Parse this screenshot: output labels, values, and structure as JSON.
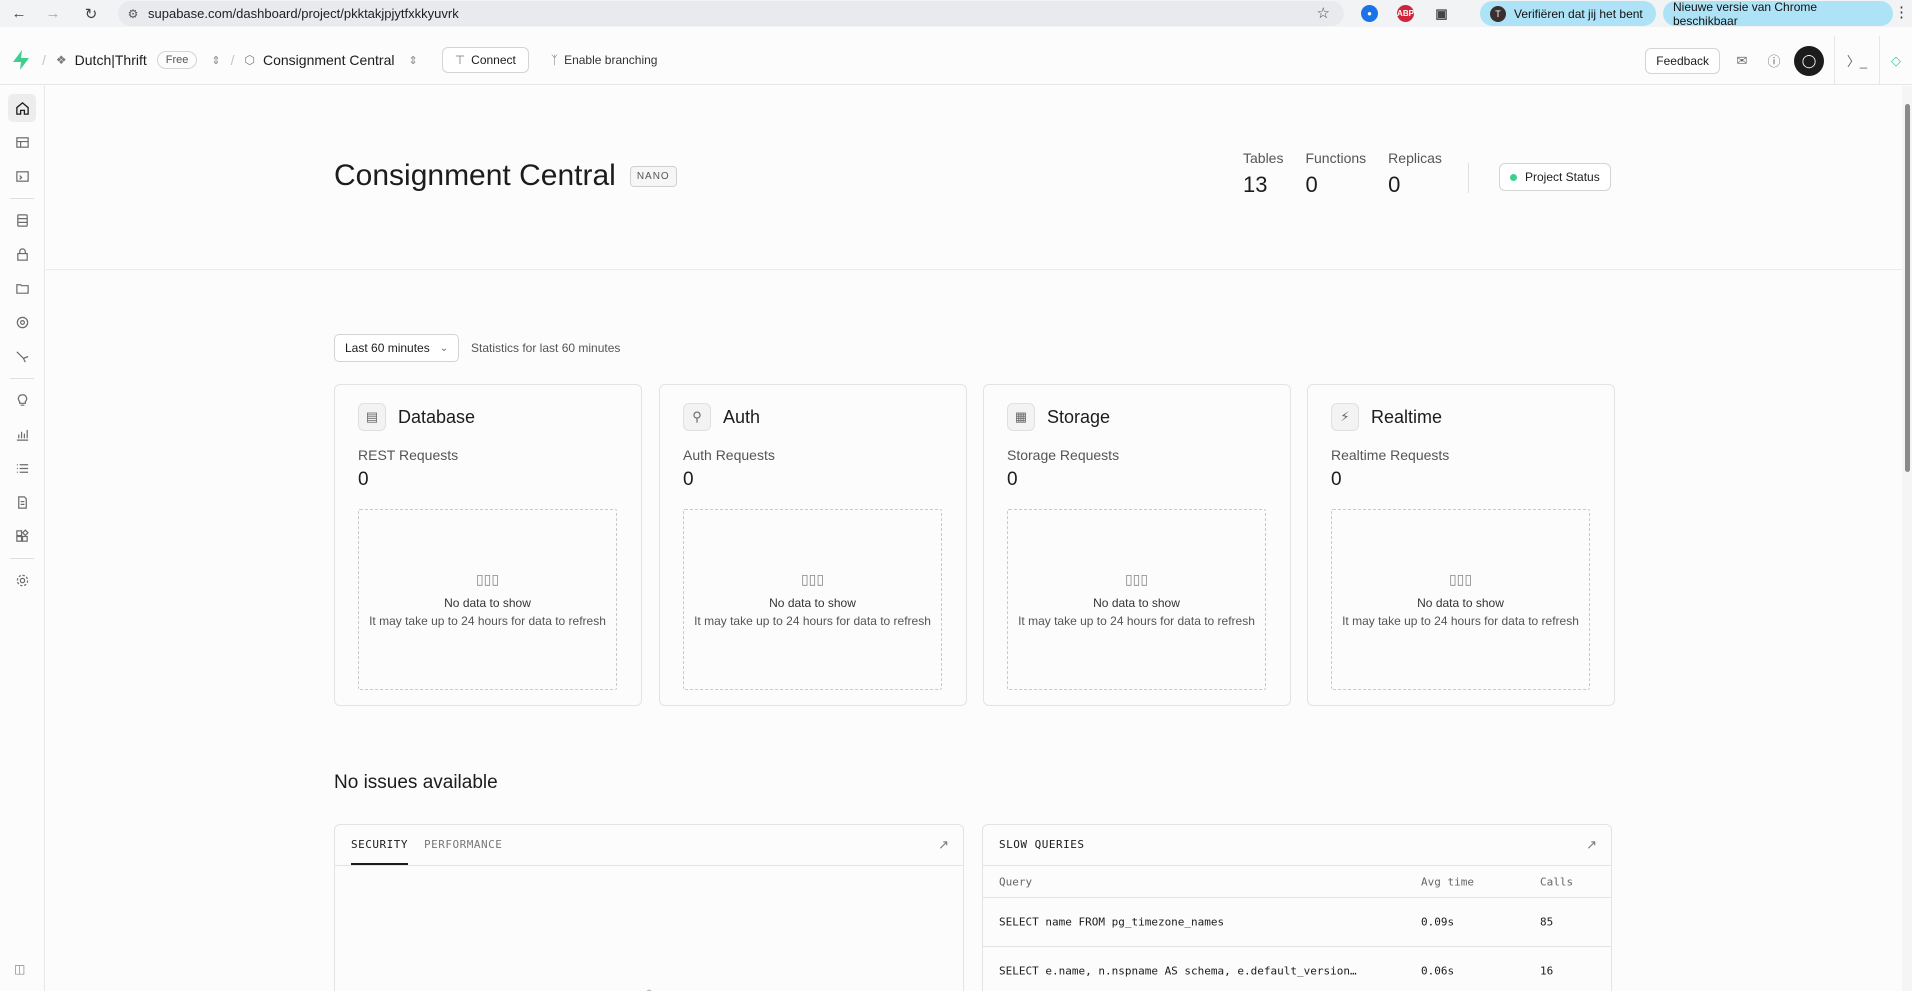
{
  "browser": {
    "url": "supabase.com/dashboard/project/pkktakjpjytfxkkyuvrk",
    "verify_pill": "Verifiëren dat jij het bent",
    "verify_avatar": "T",
    "update_pill": "Nieuwe versie van Chrome beschikbaar",
    "ext_abp": "ABP"
  },
  "header": {
    "org_name": "Dutch|Thrift",
    "plan_badge": "Free",
    "project_name": "Consignment Central",
    "connect_label": "Connect",
    "branching_label": "Enable branching",
    "feedback_label": "Feedback"
  },
  "project": {
    "title": "Consignment Central",
    "size_badge": "NANO",
    "stats": [
      {
        "label": "Tables",
        "value": "13"
      },
      {
        "label": "Functions",
        "value": "0"
      },
      {
        "label": "Replicas",
        "value": "0"
      }
    ],
    "status_label": "Project Status"
  },
  "filter": {
    "selected": "Last 60 minutes",
    "description": "Statistics for last 60 minutes"
  },
  "cards": [
    {
      "title": "Database",
      "icon": "database-icon",
      "metric_label": "REST Requests",
      "metric_value": "0",
      "empty_title": "No data to show",
      "empty_note": "It may take up to 24 hours for data to refresh"
    },
    {
      "title": "Auth",
      "icon": "key-icon",
      "metric_label": "Auth Requests",
      "metric_value": "0",
      "empty_title": "No data to show",
      "empty_note": "It may take up to 24 hours for data to refresh"
    },
    {
      "title": "Storage",
      "icon": "archive-icon",
      "metric_label": "Storage Requests",
      "metric_value": "0",
      "empty_title": "No data to show",
      "empty_note": "It may take up to 24 hours for data to refresh"
    },
    {
      "title": "Realtime",
      "icon": "bolt-icon",
      "metric_label": "Realtime Requests",
      "metric_value": "0",
      "empty_title": "No data to show",
      "empty_note": "It may take up to 24 hours for data to refresh"
    }
  ],
  "issues": {
    "title": "No issues available",
    "tabs": [
      "SECURITY",
      "PERFORMANCE"
    ]
  },
  "slow_queries": {
    "title": "SLOW QUERIES",
    "columns": [
      "Query",
      "Avg time",
      "Calls"
    ],
    "rows": [
      {
        "query": "SELECT name FROM pg_timezone_names",
        "avg": "0.09s",
        "calls": "85"
      },
      {
        "query": "SELECT e.name, n.nspname AS schema, e.default_version…",
        "avg": "0.06s",
        "calls": "16"
      }
    ]
  },
  "sidebar_icons": [
    "home-icon",
    "table-editor-icon",
    "sql-editor-icon",
    "database-icon",
    "auth-icon",
    "storage-icon",
    "realtime-icon",
    "edge-functions-icon",
    "advisors-icon",
    "reports-icon",
    "logs-icon",
    "api-docs-icon",
    "integrations-icon",
    "settings-icon"
  ],
  "colors": {
    "accent": "#3ecf8e",
    "text": "#1c1c1c"
  }
}
